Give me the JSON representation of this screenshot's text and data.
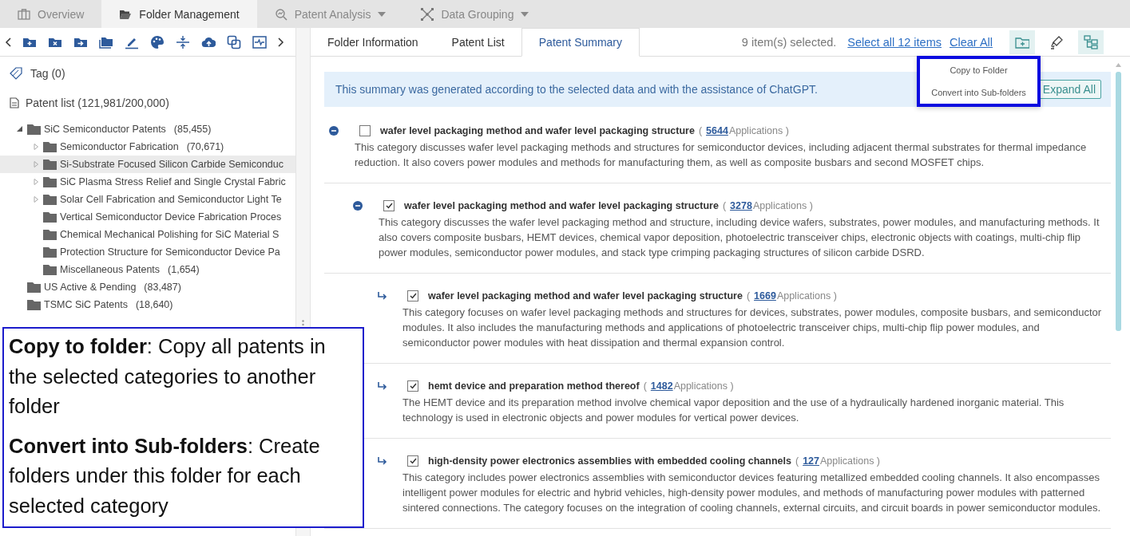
{
  "top_tabs": [
    {
      "label": "Overview",
      "selected": false,
      "dropdown": false
    },
    {
      "label": "Folder Management",
      "selected": true,
      "dropdown": false
    },
    {
      "label": "Patent Analysis",
      "selected": false,
      "dropdown": true
    },
    {
      "label": "Data Grouping",
      "selected": false,
      "dropdown": true
    }
  ],
  "tag": {
    "label": "Tag",
    "count": "(0)"
  },
  "patent_list": {
    "label": "Patent list",
    "count": "(121,981/200,000)"
  },
  "folder_tree": [
    {
      "label": "SiC Semiconductor Patents",
      "count": "(85,455)",
      "expanded": true,
      "selected": false,
      "children": [
        {
          "label": "Semiconductor Fabrication",
          "count": "(70,671)",
          "expanded": false,
          "selected": false
        },
        {
          "label": "Si-Substrate Focused Silicon Carbide Semiconduc",
          "expanded": false,
          "selected": true
        },
        {
          "label": "SiC Plasma Stress Relief and Single Crystal Fabric",
          "expanded": false,
          "selected": false
        },
        {
          "label": "Solar Cell Fabrication and Semiconductor Light Te",
          "expanded": false,
          "selected": false
        },
        {
          "label": "Vertical Semiconductor Device Fabrication Proces",
          "selected": false
        },
        {
          "label": "Chemical Mechanical Polishing for SiC Material S",
          "selected": false
        },
        {
          "label": "Protection Structure for Semiconductor Device Pa",
          "selected": false
        },
        {
          "label": "Miscellaneous Patents",
          "count": "(1,654)",
          "selected": false
        }
      ]
    },
    {
      "label": "US Active & Pending",
      "count": "(83,487)",
      "selected": false
    },
    {
      "label": "TSMC SiC Patents",
      "count": "(18,640)",
      "selected": false
    }
  ],
  "detail_tabs": [
    {
      "label": "Folder Information",
      "selected": false
    },
    {
      "label": "Patent List",
      "selected": false
    },
    {
      "label": "Patent Summary",
      "selected": true
    }
  ],
  "selection": {
    "status": "9 item(s) selected.",
    "select_all": "Select all 12 items",
    "clear_all": "Clear All"
  },
  "action_buttons": [
    {
      "kind": "add-folder",
      "selected": true
    },
    {
      "kind": "highlighter",
      "selected": false
    },
    {
      "kind": "tree",
      "selected": true
    }
  ],
  "banner": {
    "text": "This summary was generated according to the selected data and with the assistance of ChatGPT.",
    "button": "Expand All"
  },
  "popup_menu": [
    "Copy to Folder",
    "Convert into Sub-folders"
  ],
  "categories": [
    {
      "kind": "group",
      "checked": false,
      "title": "wafer level packaging method and wafer level packaging structure",
      "before": "(",
      "count": "5644",
      "after": "Applications )",
      "description": "This category discusses wafer level packaging methods and structures for semiconductor devices, including adjacent thermal substrates for thermal impedance reduction. It also covers power modules and methods for manufacturing them, as well as composite busbars and second MOSFET chips.",
      "children": [
        {
          "kind": "group",
          "checked": true,
          "title": "wafer level packaging method and wafer level packaging structure",
          "before": "(",
          "count": "3278",
          "after": "Applications )",
          "description": "This category discusses the wafer level packaging method and structure, including device wafers, substrates, power modules, and manufacturing methods. It also covers composite busbars, HEMT devices, chemical vapor deposition, photoelectric transceiver chips, electronic objects with coatings, multi-chip flip power modules, semiconductor power modules, and stack type crimping packaging structures of silicon carbide DSRD.",
          "children": [
            {
              "kind": "leaf",
              "checked": true,
              "title": "wafer level packaging method and wafer level packaging structure",
              "before": "(",
              "count": "1669",
              "after": "Applications )",
              "description": "This category focuses on wafer level packaging methods and structures for devices, substrates, power modules, composite busbars, and semiconductor modules. It also includes the manufacturing methods and applications of photoelectric transceiver chips, multi-chip flip power modules, and semiconductor power modules with heat dissipation and thermal expansion control."
            },
            {
              "kind": "leaf",
              "checked": true,
              "title": "hemt device and preparation method thereof",
              "before": "(",
              "count": "1482",
              "after": "Applications )",
              "description": "The HEMT device and its preparation method involve chemical vapor deposition and the use of a hydraulically hardened inorganic material. This technology is used in electronic objects and power modules for vertical power devices."
            },
            {
              "kind": "leaf",
              "checked": true,
              "title": "high-density power electronics assemblies with embedded cooling channels",
              "before": "(",
              "count": "127",
              "after": "Applications )",
              "description": "This category includes power electronics assemblies with semiconductor devices featuring metallized embedded cooling channels. It also encompasses intelligent power modules for electric and hybrid vehicles, high-density power modules, and methods of manufacturing power modules with patterned sintered connections. The category focuses on the integration of cooling channels, external circuits, and circuit boards in power semiconductor modules."
            }
          ]
        }
      ]
    }
  ],
  "callout": [
    "**Copy to folder**: Copy all patents in the selected categories to another folder",
    "**Convert into Sub-folders**: Create folders under this folder for each selected category"
  ]
}
